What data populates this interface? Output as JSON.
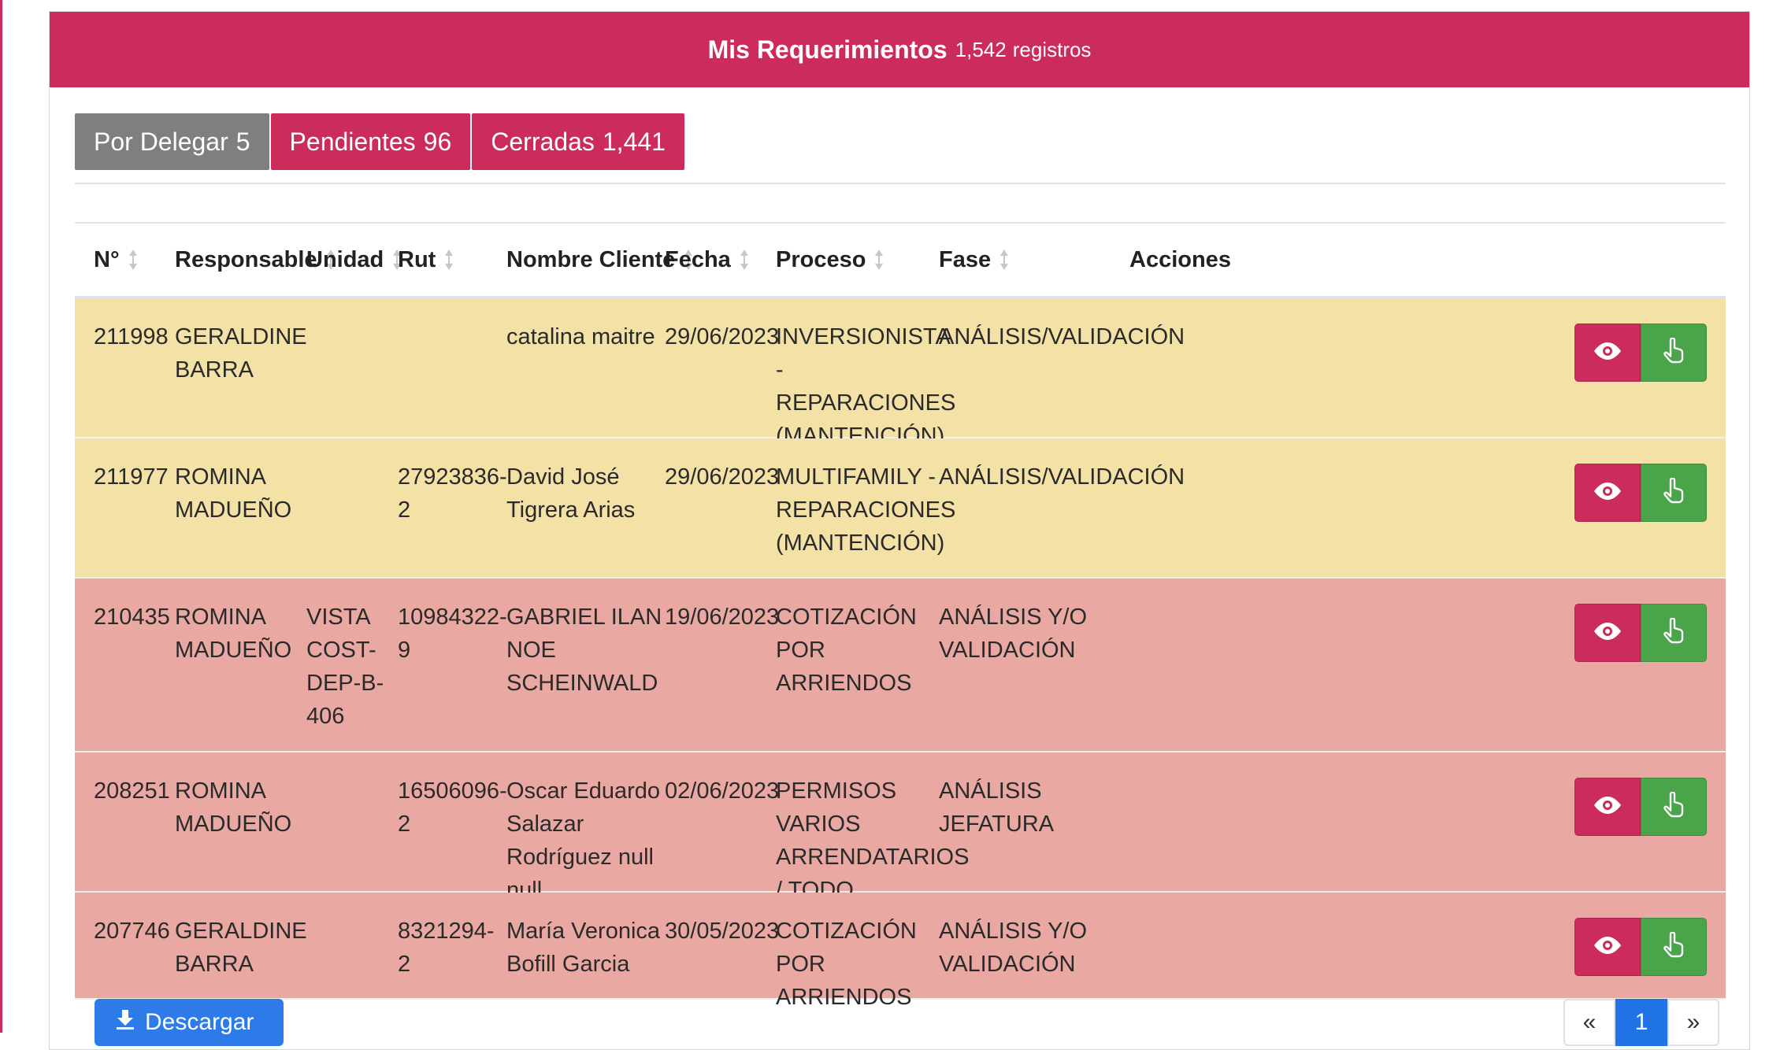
{
  "header": {
    "title": "Mis Requerimientos",
    "count": "1,542",
    "count_suffix": "registros"
  },
  "tabs": [
    {
      "label": "Por Delegar",
      "count": "5"
    },
    {
      "label": "Pendientes",
      "count": "96"
    },
    {
      "label": "Cerradas",
      "count": "1,441"
    }
  ],
  "table": {
    "columns": [
      "N°",
      "Responsable",
      "Unidad",
      "Rut",
      "Nombre Cliente",
      "Fecha",
      "Proceso",
      "Fase",
      "Acciones"
    ],
    "rows": [
      {
        "no": "211998",
        "responsable": "GERALDINE BARRA",
        "unidad": "",
        "rut": "",
        "cliente": "catalina maitre",
        "fecha": "29/06/2023",
        "proceso": "INVERSIONISTA - REPARACIONES (MANTENCIÓN)",
        "fase": "ANÁLISIS/VALIDACIÓN",
        "color": "#f3e1a6"
      },
      {
        "no": "211977",
        "responsable": "ROMINA MADUEÑO",
        "unidad": "",
        "rut": "27923836-2",
        "cliente": "David José Tigrera Arias",
        "fecha": "29/06/2023",
        "proceso": "MULTIFAMILY - REPARACIONES (MANTENCIÓN)",
        "fase": "ANÁLISIS/VALIDACIÓN",
        "color": "#f3e1a6"
      },
      {
        "no": "210435",
        "responsable": "ROMINA MADUEÑO",
        "unidad": "VISTA COST-DEP-B-406",
        "rut": "10984322-9",
        "cliente": "GABRIEL ILAN NOE SCHEINWALD",
        "fecha": "19/06/2023",
        "proceso": "COTIZACIÓN POR ARRIENDOS",
        "fase": "ANÁLISIS Y/O VALIDACIÓN",
        "color": "#e9a9a2"
      },
      {
        "no": "208251",
        "responsable": "ROMINA MADUEÑO",
        "unidad": "",
        "rut": "16506096-2",
        "cliente": "Oscar Eduardo Salazar Rodríguez null null",
        "fecha": "02/06/2023",
        "proceso": "PERMISOS VARIOS ARRENDATARIOS / TODO PERMISO",
        "fase": "ANÁLISIS JEFATURA",
        "color": "#e9a9a2"
      },
      {
        "no": "207746",
        "responsable": "GERALDINE BARRA",
        "unidad": "",
        "rut": "8321294-2",
        "cliente": "María Veronica Bofill Garcia",
        "fecha": "30/05/2023",
        "proceso": "COTIZACIÓN POR ARRIENDOS",
        "fase": "ANÁLISIS Y/O VALIDACIÓN",
        "color": "#e9a9a2"
      }
    ]
  },
  "actions": {
    "view_icon": "eye-icon",
    "take_icon": "hand-pointer-icon"
  },
  "footer": {
    "download_label": "Descargar",
    "download_icon": "download-icon"
  },
  "pagination": {
    "prev": "«",
    "current": "1",
    "next": "»"
  },
  "colors": {
    "brand": "#cb2c5b",
    "success": "#4aa44a",
    "primary": "#1f73e6",
    "tab_inactive": "#7f7f7f"
  }
}
